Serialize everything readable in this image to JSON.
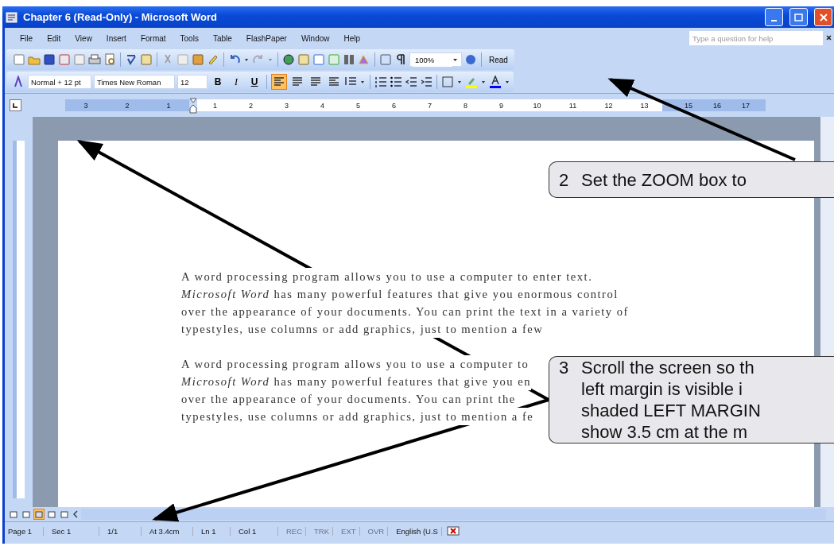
{
  "window": {
    "title": "Chapter 6 (Read-Only) - Microsoft Word"
  },
  "menu": [
    "File",
    "Edit",
    "View",
    "Insert",
    "Format",
    "Tools",
    "Table",
    "FlashPaper",
    "Window",
    "Help"
  ],
  "help_box": {
    "placeholder": "Type a question for help"
  },
  "zoom_box": {
    "value": "100%"
  },
  "read_button": "Read",
  "style_box": "Normal + 12 pt",
  "font_box": "Times New Roman",
  "size_box": "12",
  "format_buttons": [
    {
      "label": "B",
      "kind": "bold"
    },
    {
      "label": "I",
      "kind": "italic"
    },
    {
      "label": "U",
      "kind": "underline"
    }
  ],
  "alignment": [
    {
      "selected": true
    },
    {
      "selected": false
    },
    {
      "selected": false
    },
    {
      "selected": false
    }
  ],
  "ruler": {
    "left_margin_numbers": [
      "3",
      "2",
      "1"
    ],
    "numbers": [
      "1",
      "2",
      "3",
      "4",
      "5",
      "6",
      "7",
      "8",
      "9",
      "10",
      "11",
      "12",
      "13"
    ],
    "right_margin_numbers": [
      "15",
      "16",
      "17"
    ]
  },
  "document": {
    "paragraphs": [
      {
        "lines": [
          "A word processing program allows you to use a computer to enter text.",
          "*Microsoft Word* has many powerful features that give you enormous control",
          "over the appearance of your documents.  You can print the text in a variety of",
          "typestyles, use columns or add graphics, just to mention a few"
        ]
      },
      {
        "lines": [
          "A word processing program allows you to use a computer to",
          "*Microsoft Word* has many powerful features that give you en",
          "over the appearance of your documents.  You can print the",
          "typestyles, use columns or add graphics, just to mention a fe"
        ]
      }
    ]
  },
  "views": [
    {
      "selected": false
    },
    {
      "selected": false
    },
    {
      "selected": true
    },
    {
      "selected": false
    },
    {
      "selected": false
    }
  ],
  "status_bar": [
    {
      "text": "Page 1",
      "disabled": false
    },
    {
      "text": "Sec 1",
      "disabled": false
    },
    {
      "text": "1/1",
      "disabled": false
    },
    {
      "text": "At 3.4cm",
      "disabled": false
    },
    {
      "text": "Ln 1",
      "disabled": false
    },
    {
      "text": "Col 1",
      "disabled": false
    },
    {
      "text": "REC",
      "disabled": true
    },
    {
      "text": "TRK",
      "disabled": true
    },
    {
      "text": "EXT",
      "disabled": true
    },
    {
      "text": "OVR",
      "disabled": true
    },
    {
      "text": "English (U.S",
      "disabled": false
    }
  ],
  "callouts": [
    {
      "number": "2",
      "lines": [
        "Set the ZOOM box to"
      ]
    },
    {
      "number": "3",
      "lines": [
        "Scroll the screen so th",
        "left margin is visible i",
        "shaded LEFT MARGIN",
        "show 3.5 cm at the m"
      ]
    }
  ]
}
